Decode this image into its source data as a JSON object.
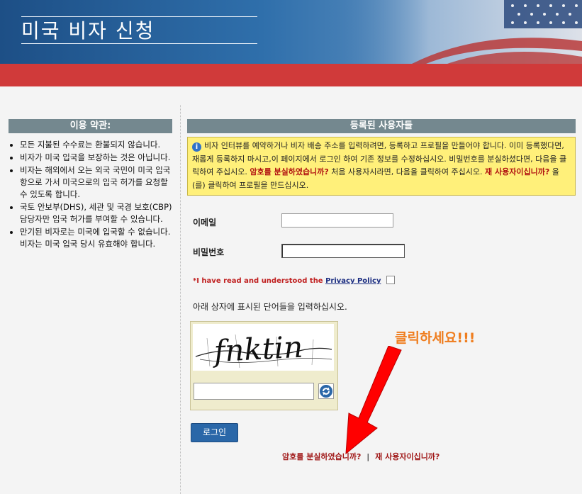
{
  "header": {
    "title": "미국 비자 신청"
  },
  "terms": {
    "heading": "이용 약관:",
    "items": [
      "모든 지불된 수수료는 환불되지 않습니다.",
      "비자가 미국 입국을 보장하는 것은 아닙니다.",
      "비자는 해외에서 오는 외국 국민이 미국 입국 항으로 가서 미국으로의 입국 허가를 요청할 수 있도록 합니다.",
      "국토 안보부(DHS), 세관 및 국경 보호(CBP) 담당자만 입국 허가를 부여할 수 있습니다.",
      "만기된 비자로는 미국에 입국할 수 없습니다. 비자는 미국 입국 당시 유효해야 합니다."
    ]
  },
  "registered": {
    "heading": "등록된 사용자들",
    "info_icon": "info-icon",
    "info_text_1": "비자 인터뷰를 예약하거나 비자 배송 주소를 입력하려면, 등록하고 프로필을 만들어야 합니다. 이미 등록했다면, 재롭게 등록하지 마시고,이 페이지에서 로그인 하여 기존 정보를 수정하십시오. 비밀번호를 분실하셨다면, 다음을 클릭하여 주십시오.",
    "forgot_link": "암호를 분실하였습니까?",
    "info_text_2": "처음 사용자시라면, 다음을 클릭하여 주십시오.",
    "new_user_link": "재 사용자이십니까?",
    "info_text_3": "을(를) 클릭하여 프로필을 만드십시오."
  },
  "form": {
    "email_label": "이메일",
    "email_value": "",
    "password_label": "비밀번호",
    "password_value": "",
    "privacy_required_prefix": "*I have read and understood the",
    "privacy_link": "Privacy Policy",
    "privacy_checked": false,
    "captcha_prompt": "아래 상자에 표시된 단어들을 입력하십시오.",
    "captcha_text": "fnktin",
    "captcha_value": "",
    "refresh_icon": "refresh-icon",
    "login_label": "로그인"
  },
  "footer_links": {
    "forgot": "암호를 분실하였습니까?",
    "separator": "|",
    "new_user": "재 사용자이십니까?"
  },
  "annotation": {
    "text": "클릭하세요!!!",
    "color": "#ef7d1e",
    "arrow_color": "#ff0000"
  },
  "colors": {
    "header_blue": "#1d4f86",
    "red_bar": "#d03a3a",
    "panel_head": "#74888f",
    "info_bg": "#fff07a",
    "login_button": "#2a67a8",
    "link_red": "#a01818"
  }
}
